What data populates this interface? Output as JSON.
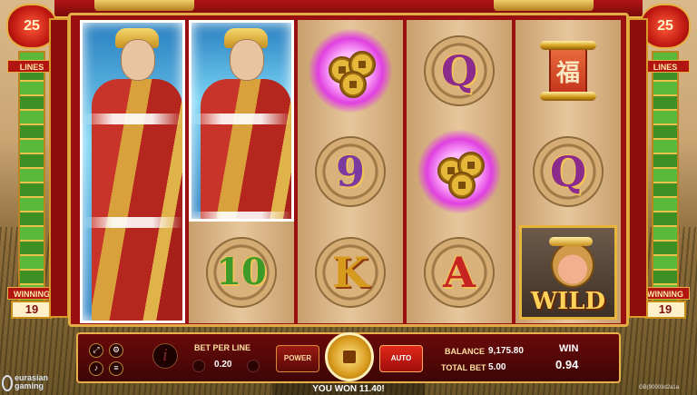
{
  "pillars": {
    "left": {
      "lines_count": "25",
      "lines_label": "LINES",
      "winning_label": "WINNING",
      "winning_count": "19"
    },
    "right": {
      "lines_count": "25",
      "lines_label": "LINES",
      "winning_label": "WINNING",
      "winning_count": "19"
    }
  },
  "reels": [
    {
      "symbols": [
        "wild-monk-stacked"
      ]
    },
    {
      "symbols": [
        "wild-monk-stacked",
        "10"
      ]
    },
    {
      "symbols": [
        "coins",
        "9",
        "K"
      ]
    },
    {
      "symbols": [
        "Q",
        "coins",
        "A"
      ]
    },
    {
      "symbols": [
        "scroll",
        "Q",
        "wild-monkey"
      ]
    }
  ],
  "symbols": {
    "q_label": "Q",
    "nine_label": "9",
    "ten_label": "10",
    "k_label": "K",
    "a_label": "A",
    "scroll_glyph": "福",
    "wild_label": "WILD"
  },
  "bottom_bar": {
    "bet_per_line_label": "BET PER LINE",
    "bet_per_line_value": "0.20",
    "power_label": "POWER",
    "auto_label": "AUTO",
    "balance_label": "BALANCE",
    "balance_value": "9,175.80",
    "total_bet_label": "TOTAL BET",
    "total_bet_value": "5.00",
    "win_label": "WIN",
    "win_value": "0.94"
  },
  "status_message": "YOU WON 11.40!",
  "brand": {
    "line1": "eurasian",
    "line2": "gaming"
  },
  "session_id": "GB(90003d2a1a"
}
